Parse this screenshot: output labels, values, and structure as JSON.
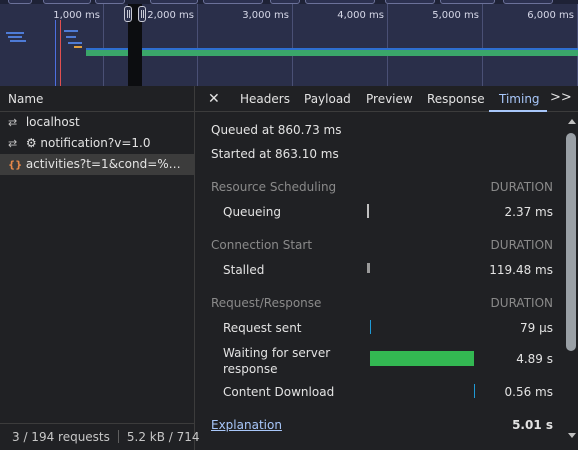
{
  "overview": {
    "ticks": [
      "1,000 ms",
      "2,000 ms",
      "3,000 ms",
      "4,000 ms",
      "5,000 ms",
      "6,000 ms"
    ]
  },
  "requests_panel": {
    "header": "Name",
    "items": [
      {
        "icon": "transfer-icon",
        "label": "localhost"
      },
      {
        "icon": "transfer-icon",
        "label": "⚙ notification?v=1.0"
      },
      {
        "icon": "xhr-icon",
        "label": "activities?t=1&cond=%7B%..."
      }
    ],
    "selected_index": 2,
    "footer": {
      "requests": "3 / 194 requests",
      "size": "5.2 kB / 714"
    }
  },
  "tabs": [
    "Headers",
    "Payload",
    "Preview",
    "Response",
    "Timing"
  ],
  "active_tab": "Timing",
  "timing": {
    "queued": "Queued at 860.73 ms",
    "started": "Started at 863.10 ms",
    "sections": [
      {
        "title": "Resource Scheduling",
        "duration_label": "DURATION",
        "rows": [
          {
            "label": "Queueing",
            "value": "2.37 ms"
          }
        ]
      },
      {
        "title": "Connection Start",
        "duration_label": "DURATION",
        "rows": [
          {
            "label": "Stalled",
            "value": "119.48 ms"
          }
        ]
      },
      {
        "title": "Request/Response",
        "duration_label": "DURATION",
        "rows": [
          {
            "label": "Request sent",
            "value": "79 µs"
          },
          {
            "label": "Waiting for server response",
            "value": "4.89 s"
          },
          {
            "label": "Content Download",
            "value": "0.56 ms"
          }
        ]
      }
    ],
    "explanation": "Explanation",
    "total": "5.01 s"
  },
  "colors": {
    "waiting_bar": "#33b852",
    "accent": "#a8c7fa",
    "request_sent_bar": "#1f9ad6"
  }
}
